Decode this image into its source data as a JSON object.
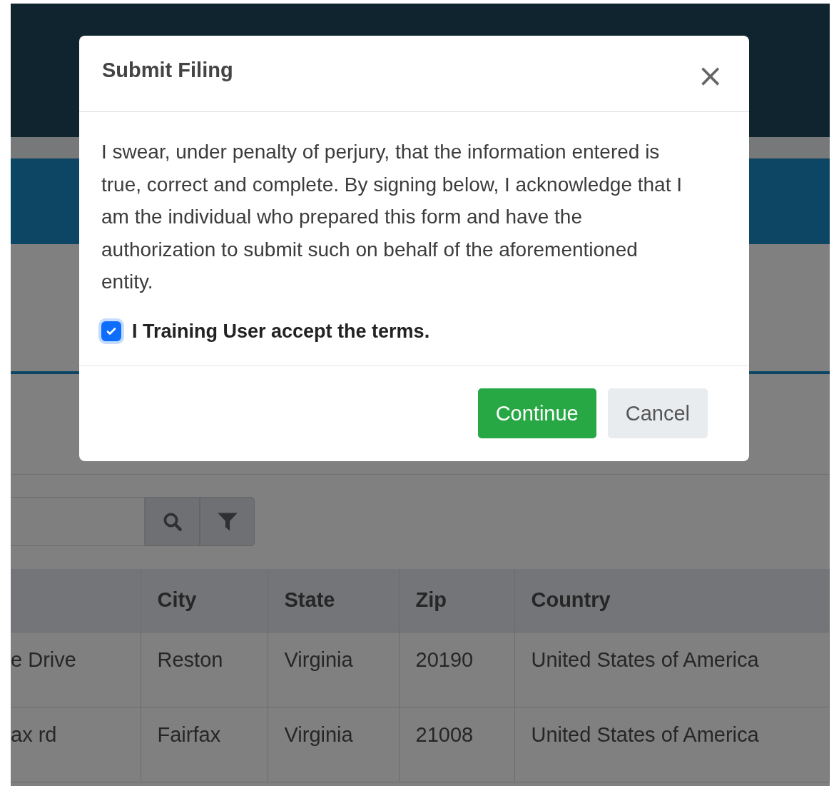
{
  "modal": {
    "title": "Submit Filing",
    "close": "×",
    "message": "I swear, under penalty of perjury, that the information entered is true, correct and complete. By signing below, I acknowledge that I am the individual who prepared this form and have the authorization to submit such on behalf of the aforementioned entity.",
    "consent": {
      "label": "I Training User accept the terms.",
      "checked": true
    },
    "buttons": [
      {
        "label": "Continue",
        "kind": "primary"
      },
      {
        "label": "Cancel",
        "kind": "secondary"
      }
    ]
  },
  "table": {
    "columns": [
      "",
      "City",
      "State",
      "Zip",
      "Country"
    ],
    "rows": [
      {
        "cells": [
          "e Drive",
          "Reston",
          "Virginia",
          "20190",
          "United States of America"
        ]
      },
      {
        "cells": [
          "ax rd",
          "Fairfax",
          "Virginia",
          "21008",
          "United States of America"
        ]
      }
    ]
  }
}
